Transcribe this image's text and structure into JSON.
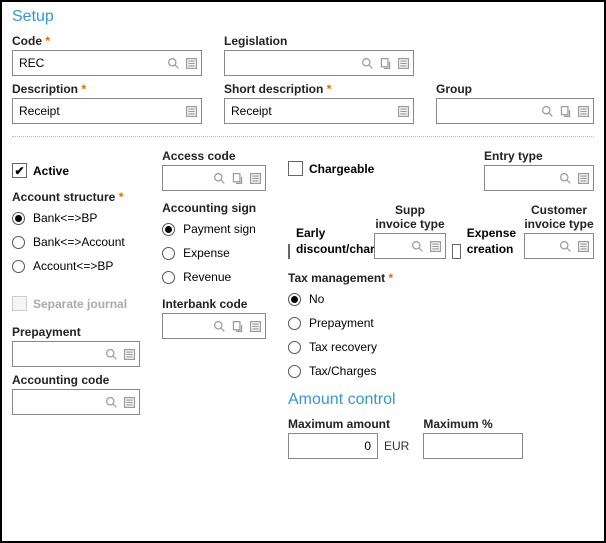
{
  "section": {
    "setup": "Setup",
    "amount": "Amount control"
  },
  "labels": {
    "code": "Code",
    "legislation": "Legislation",
    "description": "Description",
    "short_description": "Short description",
    "group": "Group",
    "active": "Active",
    "access_code": "Access code",
    "chargeable": "Chargeable",
    "entry_type": "Entry type",
    "account_structure": "Account structure",
    "accounting_sign": "Accounting sign",
    "early_discount": "Early discount/charge",
    "supp_invoice_type": "Supp invoice type",
    "expense_creation": "Expense creation",
    "customer_invoice_type": "Customer invoice type",
    "separate_journal": "Separate journal",
    "interbank_code": "Interbank code",
    "tax_management": "Tax management",
    "prepayment_field": "Prepayment",
    "accounting_code": "Accounting code",
    "maximum_amount": "Maximum amount",
    "maximum_pct": "Maximum %"
  },
  "values": {
    "code": "REC",
    "legislation": "",
    "description": "Receipt",
    "short_description": "Receipt",
    "group": "",
    "access_code": "",
    "entry_type": "",
    "supp_invoice_type": "",
    "customer_invoice_type": "",
    "interbank_code": "",
    "prepayment_field": "",
    "accounting_code": "",
    "maximum_amount": "0",
    "maximum_amount_unit": "EUR"
  },
  "radios": {
    "account_structure": [
      "Bank<=>BP",
      "Bank<=>Account",
      "Account<=>BP"
    ],
    "accounting_sign": [
      "Payment sign",
      "Expense",
      "Revenue"
    ],
    "tax_management": [
      "No",
      "Prepayment",
      "Tax recovery",
      "Tax/Charges"
    ]
  }
}
